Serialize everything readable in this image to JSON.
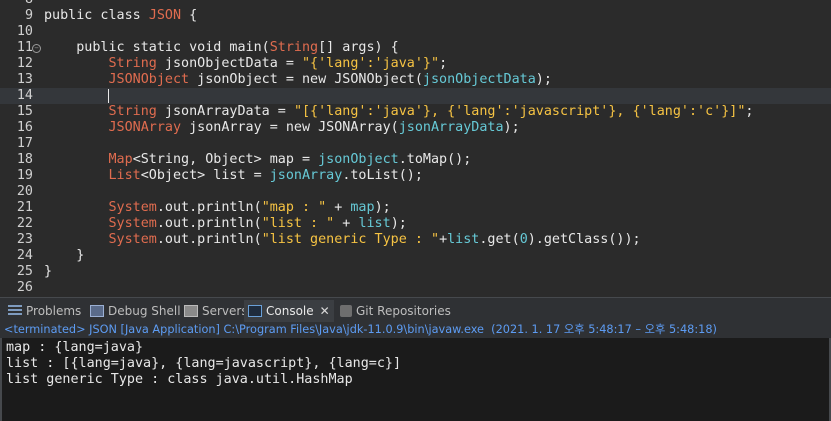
{
  "editor": {
    "lines": [
      {
        "num": "8",
        "tokens": []
      },
      {
        "num": "9",
        "tokens": [
          {
            "t": "public class ",
            "c": "keyword"
          },
          {
            "t": "JSON",
            "c": "class"
          },
          {
            "t": " {",
            "c": "punct"
          }
        ]
      },
      {
        "num": "10",
        "tokens": []
      },
      {
        "num": "11",
        "fold": true,
        "tokens": [
          {
            "t": "    public static void main(",
            "c": "keyword"
          },
          {
            "t": "String",
            "c": "class"
          },
          {
            "t": "[] args) {",
            "c": "plain"
          }
        ]
      },
      {
        "num": "12",
        "tokens": [
          {
            "t": "        ",
            "c": "plain"
          },
          {
            "t": "String",
            "c": "class"
          },
          {
            "t": " jsonObjectData = ",
            "c": "plain"
          },
          {
            "t": "\"{'lang':'java'}\"",
            "c": "string"
          },
          {
            "t": ";",
            "c": "plain"
          }
        ]
      },
      {
        "num": "13",
        "tokens": [
          {
            "t": "        ",
            "c": "plain"
          },
          {
            "t": "JSONObject",
            "c": "class"
          },
          {
            "t": " jsonObject = new JSONObject(",
            "c": "plain"
          },
          {
            "t": "jsonObjectData",
            "c": "field"
          },
          {
            "t": ");",
            "c": "plain"
          }
        ]
      },
      {
        "num": "14",
        "current": true,
        "tokens": []
      },
      {
        "num": "15",
        "tokens": [
          {
            "t": "        ",
            "c": "plain"
          },
          {
            "t": "String",
            "c": "class"
          },
          {
            "t": " jsonArrayData = ",
            "c": "plain"
          },
          {
            "t": "\"[{'lang':'java'}, {'lang':'javascript'}, {'lang':'c'}]\"",
            "c": "string"
          },
          {
            "t": ";",
            "c": "plain"
          }
        ]
      },
      {
        "num": "16",
        "tokens": [
          {
            "t": "        ",
            "c": "plain"
          },
          {
            "t": "JSONArray",
            "c": "class"
          },
          {
            "t": " jsonArray = new JSONArray(",
            "c": "plain"
          },
          {
            "t": "jsonArrayData",
            "c": "field"
          },
          {
            "t": ");",
            "c": "plain"
          }
        ]
      },
      {
        "num": "17",
        "tokens": []
      },
      {
        "num": "18",
        "tokens": [
          {
            "t": "        ",
            "c": "plain"
          },
          {
            "t": "Map",
            "c": "class"
          },
          {
            "t": "<String, Object> map = ",
            "c": "plain"
          },
          {
            "t": "jsonObject",
            "c": "field"
          },
          {
            "t": ".toMap();",
            "c": "plain"
          }
        ]
      },
      {
        "num": "19",
        "tokens": [
          {
            "t": "        ",
            "c": "plain"
          },
          {
            "t": "List",
            "c": "class"
          },
          {
            "t": "<Object> list = ",
            "c": "plain"
          },
          {
            "t": "jsonArray",
            "c": "field"
          },
          {
            "t": ".toList();",
            "c": "plain"
          }
        ]
      },
      {
        "num": "20",
        "tokens": []
      },
      {
        "num": "21",
        "tokens": [
          {
            "t": "        ",
            "c": "plain"
          },
          {
            "t": "System",
            "c": "class"
          },
          {
            "t": ".out.println(",
            "c": "plain"
          },
          {
            "t": "\"map : \"",
            "c": "string"
          },
          {
            "t": " + ",
            "c": "plain"
          },
          {
            "t": "map",
            "c": "field"
          },
          {
            "t": ");",
            "c": "plain"
          }
        ]
      },
      {
        "num": "22",
        "tokens": [
          {
            "t": "        ",
            "c": "plain"
          },
          {
            "t": "System",
            "c": "class"
          },
          {
            "t": ".out.println(",
            "c": "plain"
          },
          {
            "t": "\"list : \"",
            "c": "string"
          },
          {
            "t": " + ",
            "c": "plain"
          },
          {
            "t": "list",
            "c": "field"
          },
          {
            "t": ");",
            "c": "plain"
          }
        ]
      },
      {
        "num": "23",
        "tokens": [
          {
            "t": "        ",
            "c": "plain"
          },
          {
            "t": "System",
            "c": "class"
          },
          {
            "t": ".out.println(",
            "c": "plain"
          },
          {
            "t": "\"list generic Type : \"",
            "c": "string"
          },
          {
            "t": "+",
            "c": "plain"
          },
          {
            "t": "list",
            "c": "field"
          },
          {
            "t": ".get(",
            "c": "plain"
          },
          {
            "t": "0",
            "c": "field"
          },
          {
            "t": ").getClass());",
            "c": "plain"
          }
        ]
      },
      {
        "num": "24",
        "tokens": [
          {
            "t": "    }",
            "c": "plain"
          }
        ]
      },
      {
        "num": "25",
        "tokens": [
          {
            "t": "}",
            "c": "plain"
          }
        ]
      },
      {
        "num": "26",
        "tokens": []
      }
    ]
  },
  "tabs": [
    {
      "label": "Problems",
      "icon": "problems-icon"
    },
    {
      "label": "Debug Shell",
      "icon": "debug-shell-icon"
    },
    {
      "label": "Servers",
      "icon": "servers-icon"
    },
    {
      "label": "Console",
      "icon": "console-icon",
      "active": true,
      "close": "✕"
    },
    {
      "label": "Git Repositories",
      "icon": "git-icon"
    }
  ],
  "console": {
    "status": "<terminated> JSON [Java Application] C:\\Program Files\\Java\\jdk-11.0.9\\bin\\javaw.exe  (2021. 1. 17 오후 5:48:17 – 오후 5:48:18)",
    "output": [
      "map : {lang=java}",
      "list : [{lang=java}, {lang=javascript}, {lang=c}]",
      "list generic Type : class java.util.HashMap"
    ]
  }
}
